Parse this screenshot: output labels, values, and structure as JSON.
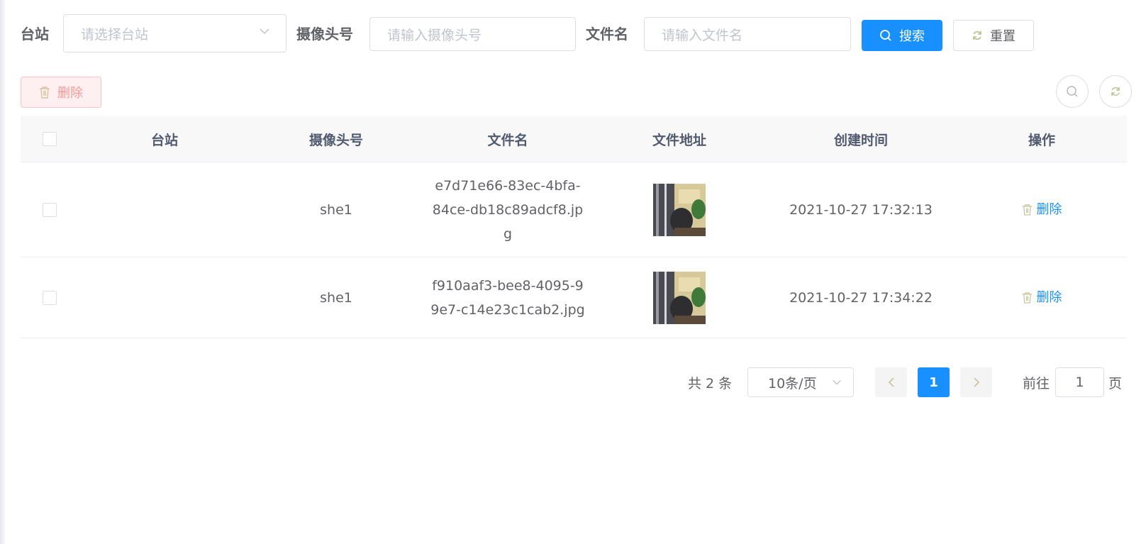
{
  "search": {
    "station_label": "台站",
    "station_placeholder": "请选择台站",
    "camera_label": "摄像头号",
    "camera_placeholder": "请输入摄像头号",
    "filename_label": "文件名",
    "filename_placeholder": "请输入文件名",
    "search_button": "搜索",
    "reset_button": "重置"
  },
  "toolbar": {
    "delete_button": "删除"
  },
  "table": {
    "columns": [
      "台站",
      "摄像头号",
      "文件名",
      "文件地址",
      "创建时间",
      "操作"
    ],
    "rows": [
      {
        "station": "",
        "camera": "she1",
        "filename_lines": [
          "e7d71e66-83ec-4bfa-",
          "84ce-db18c89adcf8.jp",
          "g"
        ],
        "created": "2021-10-27 17:32:13",
        "action": "删除"
      },
      {
        "station": "",
        "camera": "she1",
        "filename_lines": [
          "f910aaf3-bee8-4095-9",
          "9e7-c14e23c1cab2.jpg"
        ],
        "created": "2021-10-27 17:34:22",
        "action": "删除"
      }
    ]
  },
  "pagination": {
    "total_text": "共 2 条",
    "page_size": "10条/页",
    "current_page": "1",
    "goto_prefix": "前往",
    "goto_value": "1",
    "goto_suffix": "页"
  },
  "colors": {
    "primary": "#1890ff",
    "danger_light": "#fef0f0",
    "header_bg": "#f8f8f9"
  }
}
